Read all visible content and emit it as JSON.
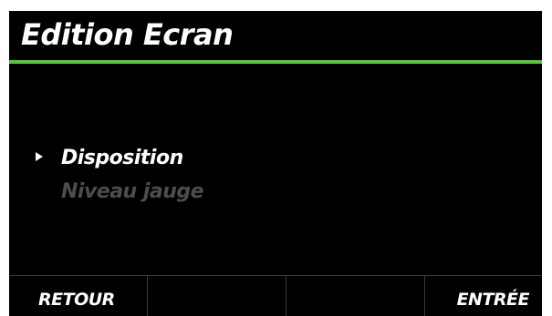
{
  "header": {
    "title": "Edition Ecran",
    "accent_color": "#5cc43c"
  },
  "menu": {
    "pointer_icon": "right-triangle-icon",
    "items": [
      {
        "label": "Disposition",
        "selected": true
      },
      {
        "label": "Niveau jauge",
        "selected": false
      }
    ]
  },
  "softkeys": [
    {
      "label": "RETOUR"
    },
    {
      "label": ""
    },
    {
      "label": ""
    },
    {
      "label": "ENTRÉE"
    }
  ],
  "colors": {
    "background": "#000000",
    "text": "#ffffff",
    "text_dim": "#4d4d4d",
    "divider": "#3a3a3a"
  }
}
